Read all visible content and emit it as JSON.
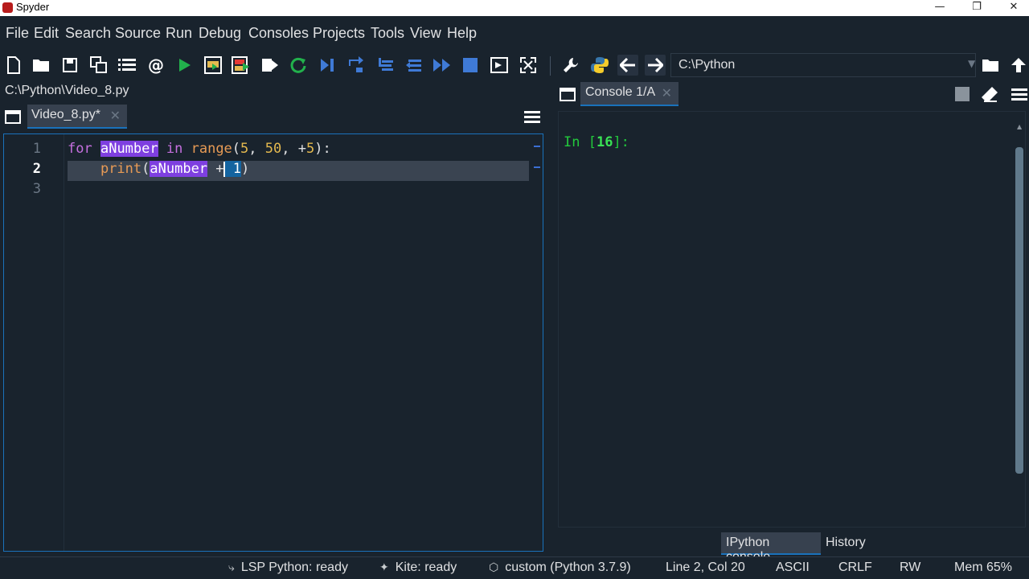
{
  "window": {
    "title": "Spyder",
    "min_icon": "minimize-icon",
    "max_icon": "restore-icon",
    "close_icon": "close-icon"
  },
  "menu": [
    "File",
    "Edit",
    "Search",
    "Source",
    "Run",
    "Debug",
    "Consoles",
    "Projects",
    "Tools",
    "View",
    "Help"
  ],
  "toolbar": {
    "icons": [
      "new-file-icon",
      "open-file-icon",
      "save-icon",
      "save-all-icon",
      "outline-icon",
      "at-icon",
      "run-icon",
      "run-cell-icon",
      "run-cell-advance-icon",
      "run-selection-icon",
      "rerun-icon",
      "debug-icon",
      "step-icon",
      "step-into-icon",
      "step-return-icon",
      "continue-icon",
      "stop-icon",
      "maximize-pane-icon",
      "fullscreen-icon",
      "preferences-icon",
      "python-path-icon",
      "back-icon",
      "forward-icon"
    ],
    "working_dir": "C:\\Python"
  },
  "editor": {
    "file_path": "C:\\Python\\Video_8.py",
    "tab_label": "Video_8.py*",
    "line_numbers": [
      "1",
      "2",
      "3"
    ],
    "current_line": "2",
    "line1": {
      "kw_for": "for",
      "var": "aNumber",
      "kw_in": "in",
      "fn": "range",
      "open": "(",
      "n1": "5",
      "c1": ", ",
      "n2": "50",
      "c2": ", ",
      "plus": "+",
      "n3": "5",
      "close": "):"
    },
    "line2": {
      "fn": "print",
      "open": "(",
      "var": "aNumber",
      "op": " +",
      "sel": " 1",
      "close": ")"
    }
  },
  "console": {
    "tab_label": "Console 1/A",
    "prompt_in": "In [",
    "prompt_num": "16",
    "prompt_end": "]:",
    "bottom_tabs": [
      "IPython console",
      "History"
    ]
  },
  "status": {
    "lsp": "LSP Python: ready",
    "kite": "Kite: ready",
    "env": "custom (Python 3.7.9)",
    "position": "Line 2, Col 20",
    "encoding": "ASCII",
    "eol": "CRLF",
    "perm": "RW",
    "mem": "Mem 65%"
  },
  "colors": {
    "background": "#19232d",
    "accent": "#1a72bb",
    "keyword": "#c670e0",
    "function": "#e89b55",
    "number": "#e4b94f",
    "prompt": "#22c93c",
    "occurrence_highlight": "#7e3fe0"
  }
}
